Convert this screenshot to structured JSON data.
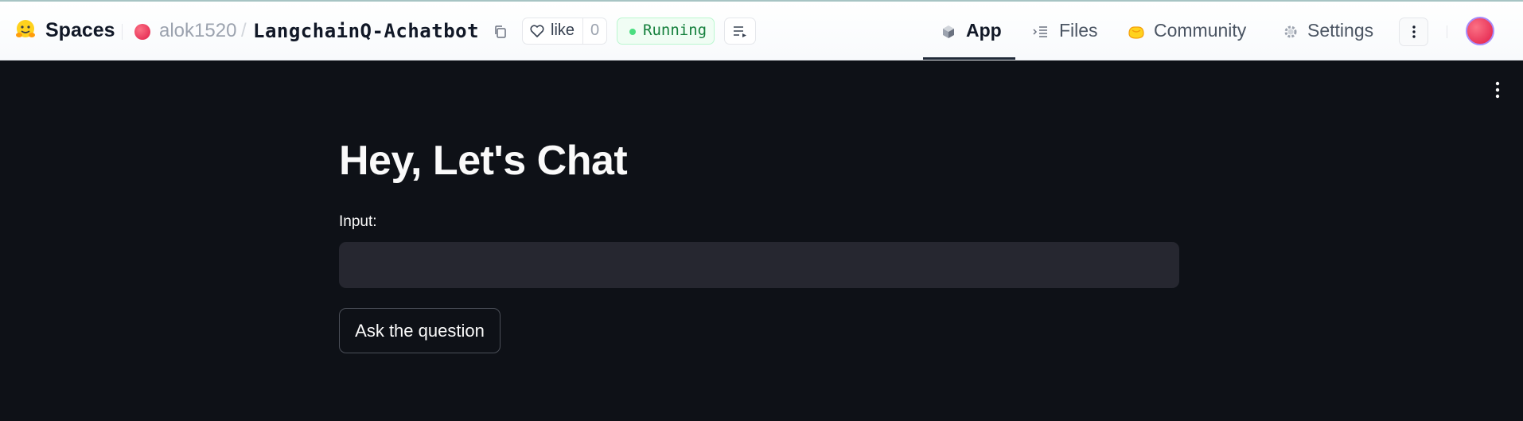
{
  "header": {
    "brand": "Spaces",
    "owner": "alok1520",
    "separator": "/",
    "repo": "LangchainQ-Achatbot",
    "like": {
      "label": "like",
      "count": "0"
    },
    "status": "Running",
    "tabs": [
      {
        "label": "App",
        "icon": "cube-icon",
        "active": true
      },
      {
        "label": "Files",
        "icon": "files-icon",
        "active": false
      },
      {
        "label": "Community",
        "icon": "hugging-hands-icon",
        "active": false
      },
      {
        "label": "Settings",
        "icon": "gear-icon",
        "active": false
      }
    ]
  },
  "app": {
    "title": "Hey, Let's Chat",
    "input_label": "Input:",
    "input_value": "",
    "button_label": "Ask the question"
  },
  "colors": {
    "app_background": "#0e1117",
    "input_background": "#262730",
    "status_green": "#15803d",
    "avatar": "#e11d48"
  }
}
